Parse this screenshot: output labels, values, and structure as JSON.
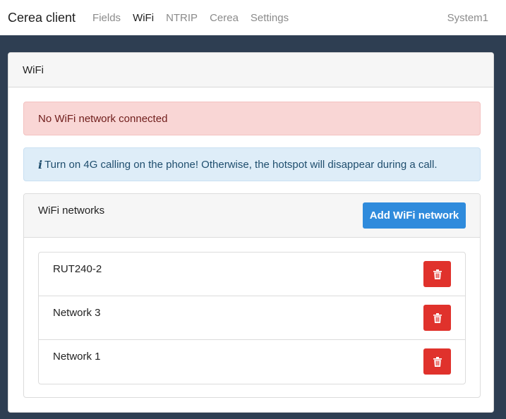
{
  "navbar": {
    "brand": "Cerea client",
    "links": [
      "Fields",
      "WiFi",
      "NTRIP",
      "Cerea",
      "Settings"
    ],
    "active": "WiFi",
    "system": "System1"
  },
  "card": {
    "title": "WiFi"
  },
  "alerts": {
    "danger": "No WiFi network connected",
    "info": "Turn on 4G calling on the phone! Otherwise, the hotspot will disappear during a call."
  },
  "networks_panel": {
    "title": "WiFi networks",
    "add_button_label": "Add WiFi network",
    "items": [
      {
        "name": "RUT240-2"
      },
      {
        "name": "Network 3"
      },
      {
        "name": "Network 1"
      }
    ]
  },
  "colors": {
    "background": "#2e3e52",
    "primary": "#2f8bdc",
    "danger": "#e0322c",
    "alert_danger_bg": "#f9d6d5",
    "alert_info_bg": "#deedf8"
  },
  "icons": {
    "info": "info-icon",
    "delete": "trash-icon"
  }
}
